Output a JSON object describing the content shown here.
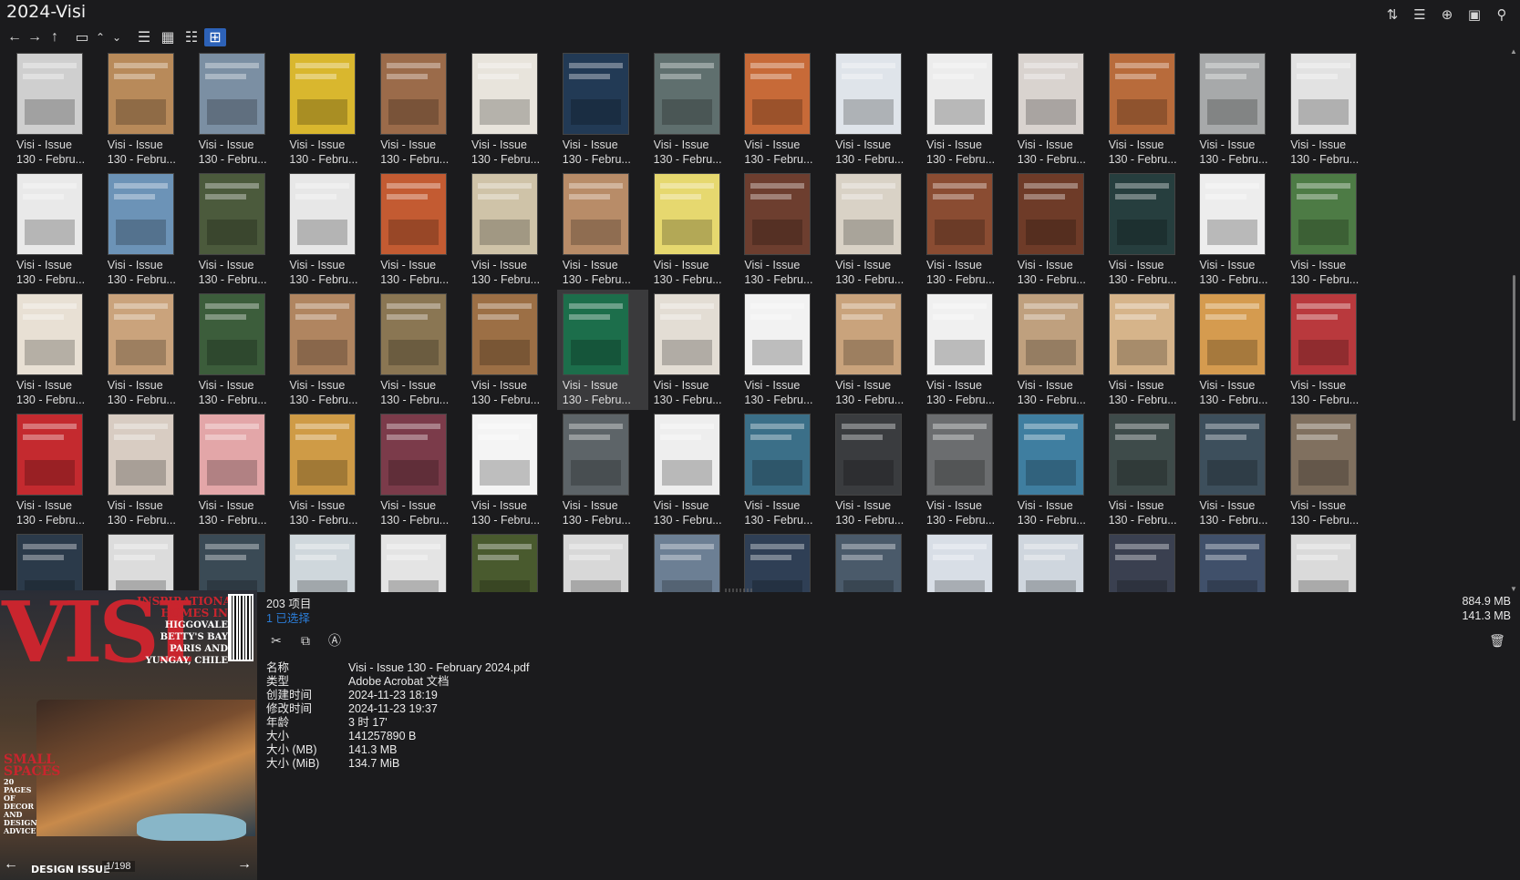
{
  "window": {
    "title": "2024-Visi"
  },
  "toolbar": {
    "right_tools": [
      {
        "icon": "sort-icon",
        "glyph": "⇅"
      },
      {
        "icon": "list-view-icon",
        "glyph": "☰"
      },
      {
        "icon": "add-circle-icon",
        "glyph": "⊕"
      },
      {
        "icon": "clipboard-icon",
        "glyph": "▣"
      },
      {
        "icon": "pin-icon",
        "glyph": "⚲"
      }
    ],
    "nav": [
      {
        "icon": "back-arrow-icon",
        "glyph": "←"
      },
      {
        "icon": "forward-arrow-icon",
        "glyph": "→"
      },
      {
        "icon": "up-arrow-icon",
        "glyph": "↑"
      }
    ],
    "views": [
      {
        "icon": "folder-icon",
        "glyph": "▭"
      },
      {
        "icon": "chevron-up-icon",
        "glyph": "⌃"
      },
      {
        "icon": "chevron-down-icon",
        "glyph": "⌄"
      },
      {
        "icon": "details-view-icon",
        "glyph": "☰"
      },
      {
        "icon": "tiles-view-icon",
        "glyph": "▦"
      },
      {
        "icon": "tree-view-icon",
        "glyph": "☷"
      },
      {
        "icon": "thumbnail-view-icon",
        "glyph": "⊞"
      }
    ]
  },
  "grid": {
    "caption_line1": "Visi - Issue",
    "caption_line2": "130 - Febru...",
    "thumbnail_colors": [
      "#cfcfcf",
      "#b88a5a",
      "#7b8fa3",
      "#d9b72e",
      "#9b6b4a",
      "#e8e4dc",
      "#223a55",
      "#5f6f6e",
      "#c76a38",
      "#dfe4ea",
      "#ececec",
      "#d9d3cf",
      "#b86b3b",
      "#a7a9aa",
      "#e2e2e2",
      "#e9e9e9",
      "#6c93b7",
      "#4b5a3c",
      "#e7e7e7",
      "#c35b32",
      "#cfc3a8",
      "#b88c68",
      "#e6d86f",
      "#6d3e2f",
      "#d9d2c6",
      "#8a4c32",
      "#6e3b28",
      "#263e3e",
      "#ededed",
      "#4d7b45",
      "#e8e0d4",
      "#caa37c",
      "#3c5d3b",
      "#b08560",
      "#8a7653",
      "#9c6f45",
      "#1c6e4b",
      "#e3ddd4",
      "#f2f2f2",
      "#c9a37c",
      "#f0f0f0",
      "#bfa07e",
      "#d6b48a",
      "#d59b4f",
      "#b9393d",
      "#c42a2f",
      "#d8ccc2",
      "#e3a6a8",
      "#cf9b46",
      "#7b3b4a",
      "#f4f4f4",
      "#5d6468",
      "#eeeeee",
      "#3b6f88",
      "#3a3c3f",
      "#6b6d6f",
      "#3f7ea0",
      "#3e4b4a",
      "#3d4f5c",
      "#80705f",
      "#2b3a4a",
      "#dcdcdc",
      "#3a4a55",
      "#cfd7dc",
      "#e4e4e4",
      "#495a2e",
      "#d8d8d8",
      "#6c7f94",
      "#2f3f55",
      "#4a5a6a",
      "#d8dee6",
      "#cfd6de",
      "#3a4050",
      "#40506a",
      "#dadada"
    ],
    "selected_index": 36
  },
  "preview": {
    "cover_title": "VISI",
    "cover_side_line1": "INSPIRATIONAL",
    "cover_side_line2": "HOMES IN",
    "cover_side_places": "HIGGOVALE\nBETTY'S BAY\nPARIS AND\nYUNGAY, CHILE",
    "cover_small_title": "SMALL SPACES",
    "cover_small_sub": "20 PAGES OF DECOR AND DESIGN ADVICE",
    "cover_bottom": "DESIGN ISSUE",
    "page_counter": "1/198",
    "prev_glyph": "←",
    "next_glyph": "→"
  },
  "info": {
    "item_count": "203 项目",
    "selected_count": "1 已选择",
    "total_size": "884.9 MB",
    "selected_size": "141.3 MB",
    "actions": [
      {
        "icon": "cut-icon",
        "glyph": "✂"
      },
      {
        "icon": "copy-icon",
        "glyph": "⧉"
      },
      {
        "icon": "rename-icon",
        "glyph": "Ⓐ"
      }
    ],
    "trash_glyph": "🗑",
    "properties": [
      {
        "key": "名称",
        "value": "Visi - Issue 130 - February 2024.pdf"
      },
      {
        "key": "类型",
        "value": "Adobe Acrobat 文档"
      },
      {
        "key": "创建时间",
        "value": "2024-11-23  18:19"
      },
      {
        "key": "修改时间",
        "value": "2024-11-23  19:37"
      },
      {
        "key": "年龄",
        "value": "3 时 17'"
      },
      {
        "key": "大小",
        "value": "141257890 B"
      },
      {
        "key": "大小 (MB)",
        "value": "141.3 MB"
      },
      {
        "key": "大小 (MiB)",
        "value": "134.7 MiB"
      }
    ]
  }
}
